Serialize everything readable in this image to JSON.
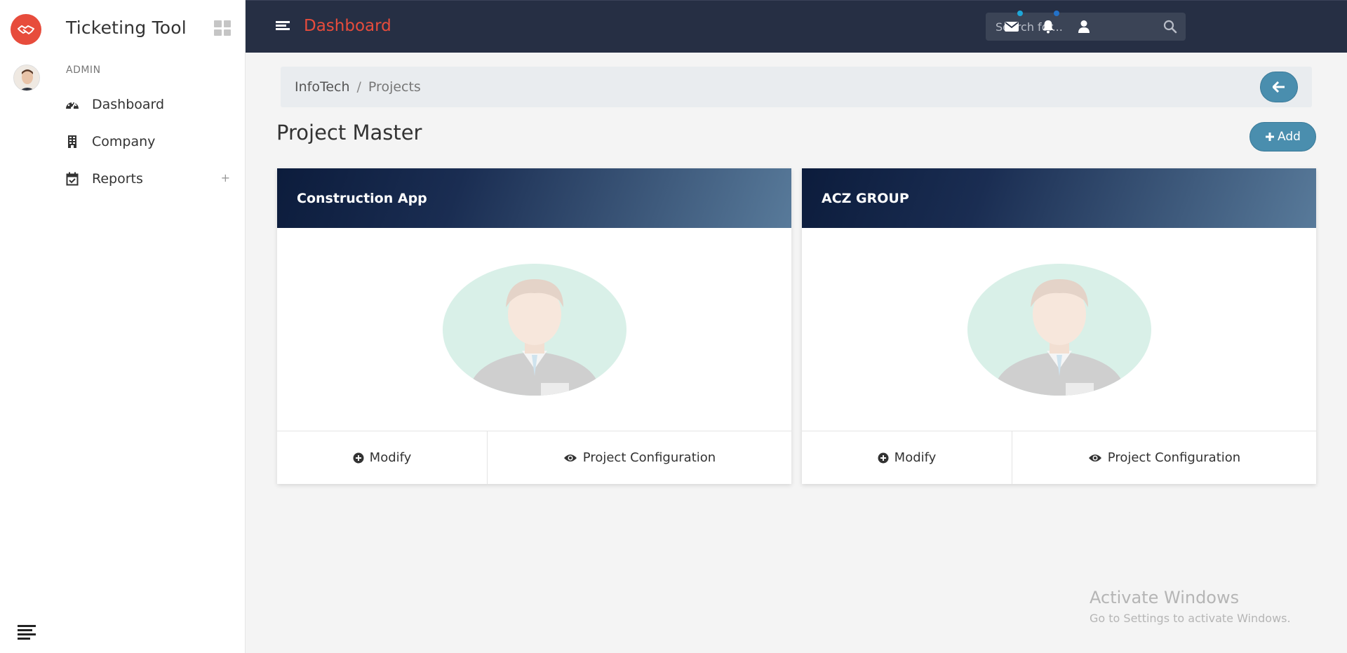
{
  "sidebar": {
    "app_title": "Ticketing Tool",
    "role": "ADMIN",
    "items": [
      {
        "label": "Dashboard",
        "icon": "gauge-icon"
      },
      {
        "label": "Company",
        "icon": "building-icon"
      },
      {
        "label": "Reports",
        "icon": "calendar-check-icon",
        "expand": "+"
      }
    ]
  },
  "topbar": {
    "title": "Dashboard",
    "search_placeholder": "Search for..."
  },
  "breadcrumb": {
    "root": "InfoTech",
    "separator": "/",
    "current": "Projects"
  },
  "main": {
    "page_title": "Project Master",
    "add_label": "Add"
  },
  "projects": [
    {
      "name": "Construction App",
      "modify_label": "Modify",
      "config_label": "Project Configuration"
    },
    {
      "name": "ACZ GROUP",
      "modify_label": "Modify",
      "config_label": "Project Configuration"
    }
  ],
  "watermark": {
    "line1": "Activate Windows",
    "line2": "Go to Settings to activate Windows."
  },
  "colors": {
    "brand_red": "#e74c3c",
    "topbar_bg": "#262f44",
    "accent_blue": "#4a8eae",
    "mail_dot": "#1ea7d8",
    "bell_dot": "#2372c9"
  }
}
